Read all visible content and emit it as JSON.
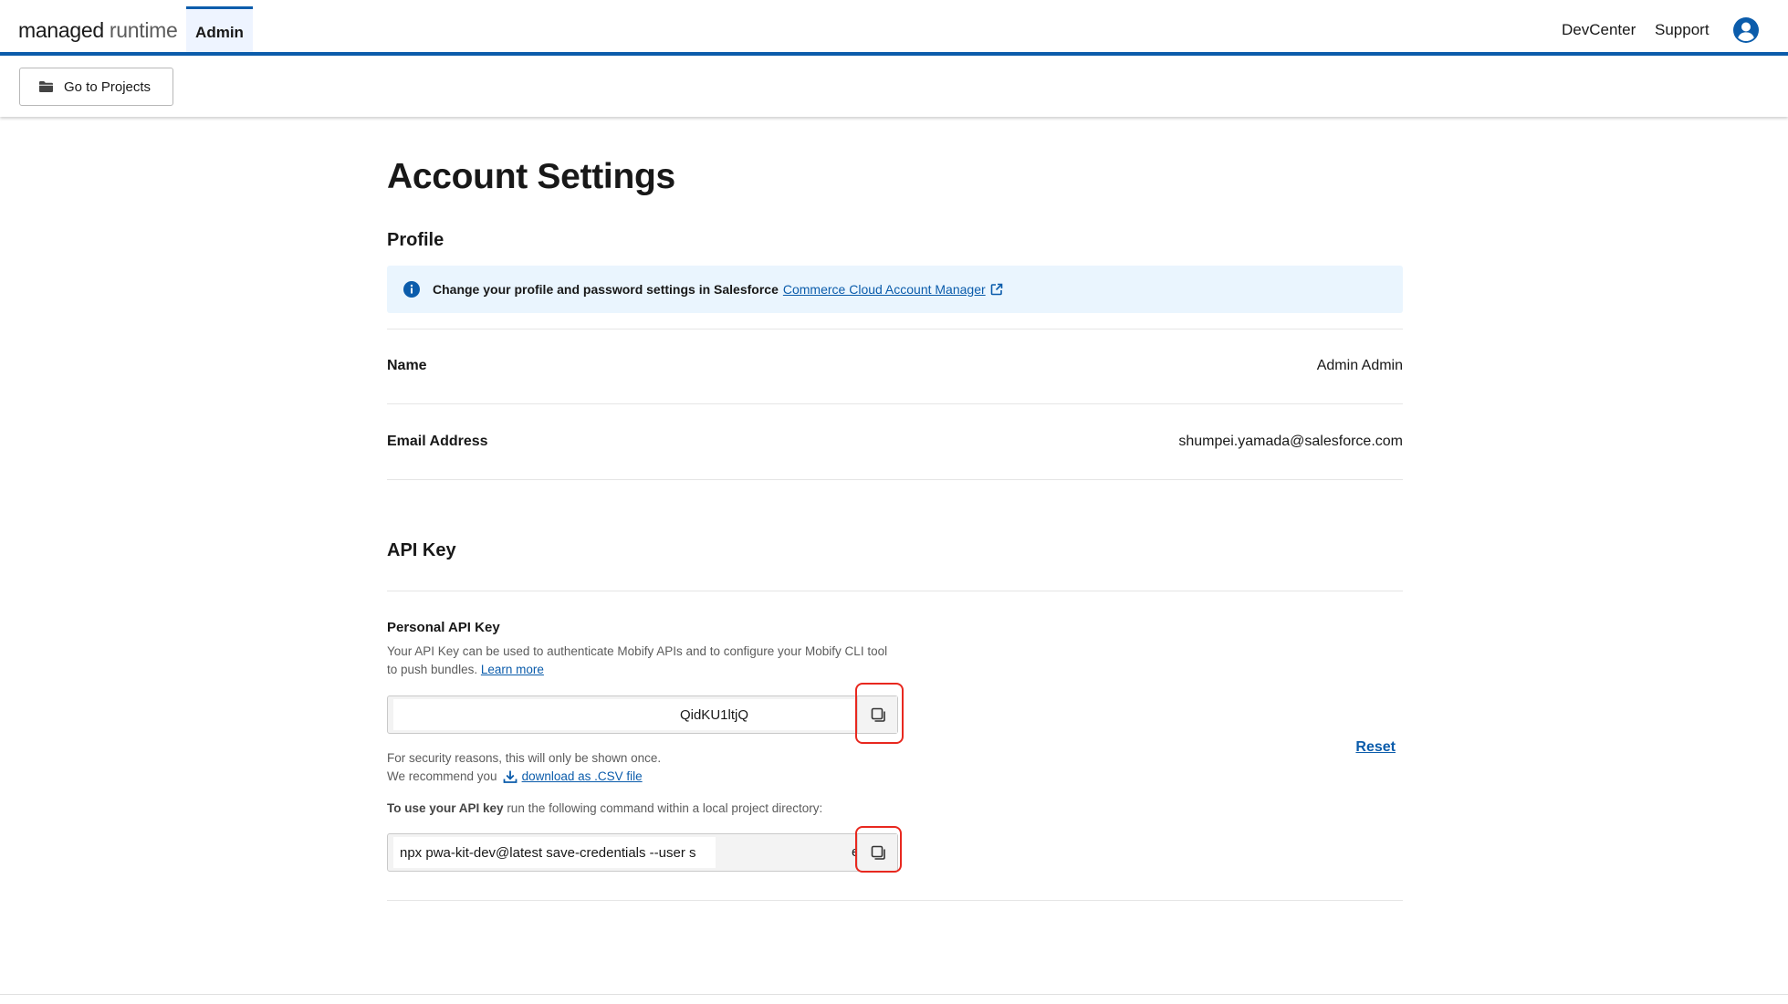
{
  "header": {
    "brand_main": "managed",
    "brand_thin": "runtime",
    "admin_tab": "Admin",
    "links": {
      "devcenter": "DevCenter",
      "support": "Support"
    },
    "accent": "#0b5cab"
  },
  "subbar": {
    "projects_button": "Go to Projects"
  },
  "page": {
    "title": "Account Settings"
  },
  "profile": {
    "title": "Profile",
    "banner_text": "Change your profile and password settings in Salesforce",
    "banner_link": "Commerce Cloud Account Manager",
    "rows": [
      {
        "label": "Name",
        "value": "Admin Admin"
      },
      {
        "label": "Email Address",
        "value": "shumpei.yamada@salesforce.com"
      }
    ]
  },
  "api_key": {
    "title": "API Key",
    "label": "Personal API Key",
    "description": "Your API Key can be used to authenticate Mobify APIs and to configure your Mobify CLI tool to push bundles.",
    "learn_more": "Learn more",
    "key_value": "QidKU1ltjQ",
    "security_line1": "For security reasons, this will only be shown once.",
    "security_line2": "We recommend you",
    "download_link": "download as .CSV file",
    "use_bold": "To use your API key",
    "use_rest": "run the following command within a local project directory:",
    "command_value": "npx pwa-kit-dev@latest save-credentials --user s",
    "command_tail": "e",
    "reset": "Reset"
  },
  "icons": {
    "folder": "folder-icon",
    "user": "user-avatar-icon",
    "info": "info-icon",
    "external": "external-link-icon",
    "copy": "copy-icon",
    "download": "download-icon"
  },
  "highlight_color": "#e8281f"
}
